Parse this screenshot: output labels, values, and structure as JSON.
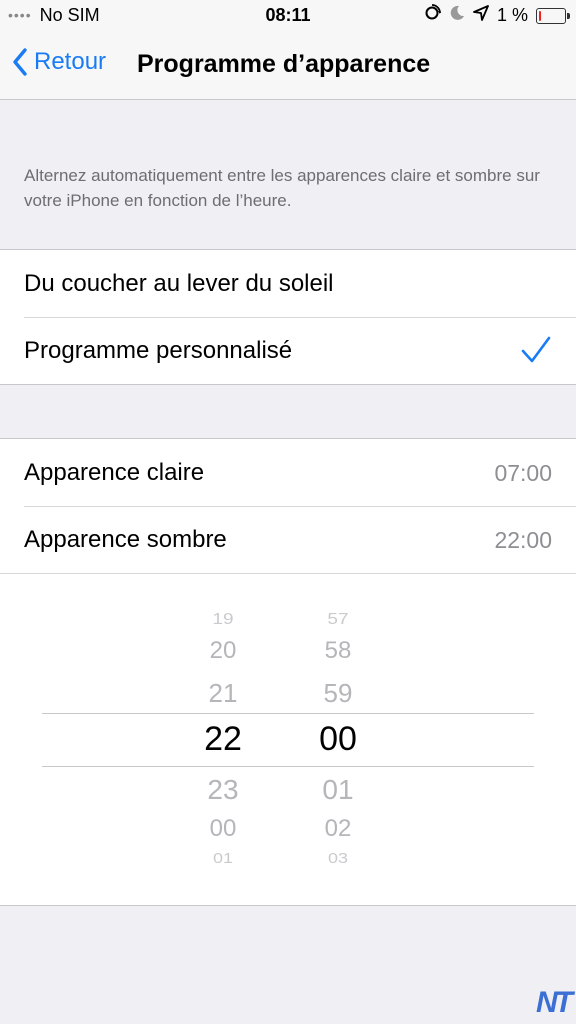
{
  "status": {
    "signal_dots": "••••",
    "carrier": "No SIM",
    "time": "08:11",
    "battery_percent": "1 %",
    "battery_level": 0.01
  },
  "nav": {
    "back_label": "Retour",
    "title": "Programme d’apparence"
  },
  "description": "Alternez automatiquement entre les apparences claire et sombre sur votre iPhone en fonction de l’heure.",
  "schedule_options": [
    {
      "label": "Du coucher au lever du soleil",
      "selected": false
    },
    {
      "label": "Programme personnalisé",
      "selected": true
    }
  ],
  "times": {
    "light_label": "Apparence claire",
    "light_value": "07:00",
    "dark_label": "Apparence sombre",
    "dark_value": "22:00"
  },
  "picker": {
    "hours": [
      "19",
      "20",
      "21",
      "22",
      "23",
      "00",
      "01"
    ],
    "minutes": [
      "57",
      "58",
      "59",
      "00",
      "01",
      "02",
      "03"
    ],
    "selected_hour": "22",
    "selected_minute": "00"
  },
  "accent_color": "#1a7cf4",
  "watermark": "NT"
}
